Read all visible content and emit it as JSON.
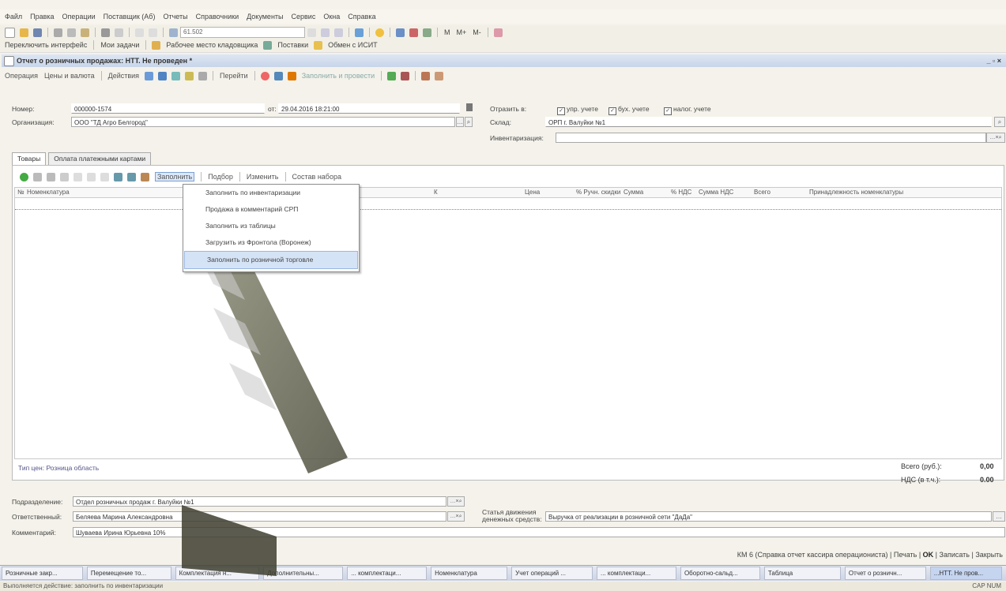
{
  "menu": [
    "Файл",
    "Правка",
    "Операции",
    "Поставщик (Аб)",
    "Отчеты",
    "Справочники",
    "Документы",
    "Сервис",
    "Окна",
    "Справка"
  ],
  "toolbar": {
    "search_value": "61.502",
    "memory_buttons": [
      "M",
      "M+",
      "M-"
    ],
    "row2": [
      "Переключить интерфейс",
      "Мои задачи",
      "Рабочее место кладовщика",
      "Поставки",
      "Обмен с ИСИТ"
    ]
  },
  "window": {
    "title": "Отчет о розничных продажах: НТТ. Не проведен *",
    "controls": "_ ▫ ×"
  },
  "actions": {
    "operation": "Операция",
    "prices": "Цены и валюта",
    "actions": "Действия",
    "goto": "Перейти",
    "fill_and_post": "Заполнить и провести"
  },
  "form": {
    "number_label": "Номер:",
    "number": "000000-1574",
    "date_label": "от:",
    "date": "29.04.2016 18:21:00",
    "org_label": "Организация:",
    "org": "ООО \"ТД Агро Белгород\"",
    "reflect_label": "Отразить в:",
    "checks": [
      "упр. учете",
      "бух. учете",
      "налог. учете"
    ],
    "warehouse_label": "Склад:",
    "warehouse": "ОРП г. Валуйки №1",
    "inventory_label": "Инвентаризация:",
    "inventory": ""
  },
  "tabs": [
    "Товары",
    "Оплата платежными картами"
  ],
  "gridtools": {
    "fill": "Заполнить",
    "select": "Подбор",
    "change": "Изменить",
    "set": "Состав набора"
  },
  "grid_headers": [
    "№",
    "Номенклатура",
    "К",
    "Цена",
    "% Ручн. скидки",
    "Сумма",
    "% НДС",
    "Сумма НДС",
    "Всего",
    "Принадлежность номенклатуры"
  ],
  "fill_menu": [
    "Заполнить по инвентаризации",
    "Продажа в комментарий СРП",
    "Заполнить из таблицы",
    "Загрузить из Фронтола (Воронеж)",
    "Заполнить по розничной торговле"
  ],
  "price_type": "Тип цен: Розница область",
  "totals": {
    "total_label": "Всего (руб.):",
    "total": "0,00",
    "vat_label": "НДС (в т.ч.):",
    "vat": "0.00"
  },
  "bottom": {
    "division_label": "Подразделение:",
    "division": "Отдел розничных продаж г. Валуйки №1",
    "resp_label": "Ответственный:",
    "resp": "Беляева Марина Александровна",
    "flow_label": "Статья движения денежных средств:",
    "flow": "Выручка от реализации в розничной сети \"ДаДа\"",
    "comment_label": "Комментарий:",
    "comment": "Шуваева Ирина Юрьевна 10%"
  },
  "footer": {
    "km6": "КМ 6 (Справка отчет кассира операциониста)",
    "print": "Печать",
    "ok": "OK",
    "save": "Записать",
    "close": "Закрыть"
  },
  "taskbar": [
    "Розничные закр...",
    "Перемещение то...",
    "Комплектация н...",
    "Дополнительны...",
    "... комплектаци...",
    "Номенклатура",
    "Учет операций ...",
    "... комплектаци...",
    "Оборотно-сальд...",
    "Таблица",
    "Отчет о розничн...",
    "...НТТ. Не пров..."
  ],
  "statusbar": {
    "text": "Выполняется действие: заполнить по инвентаризации",
    "right": "CAP  NUM"
  }
}
